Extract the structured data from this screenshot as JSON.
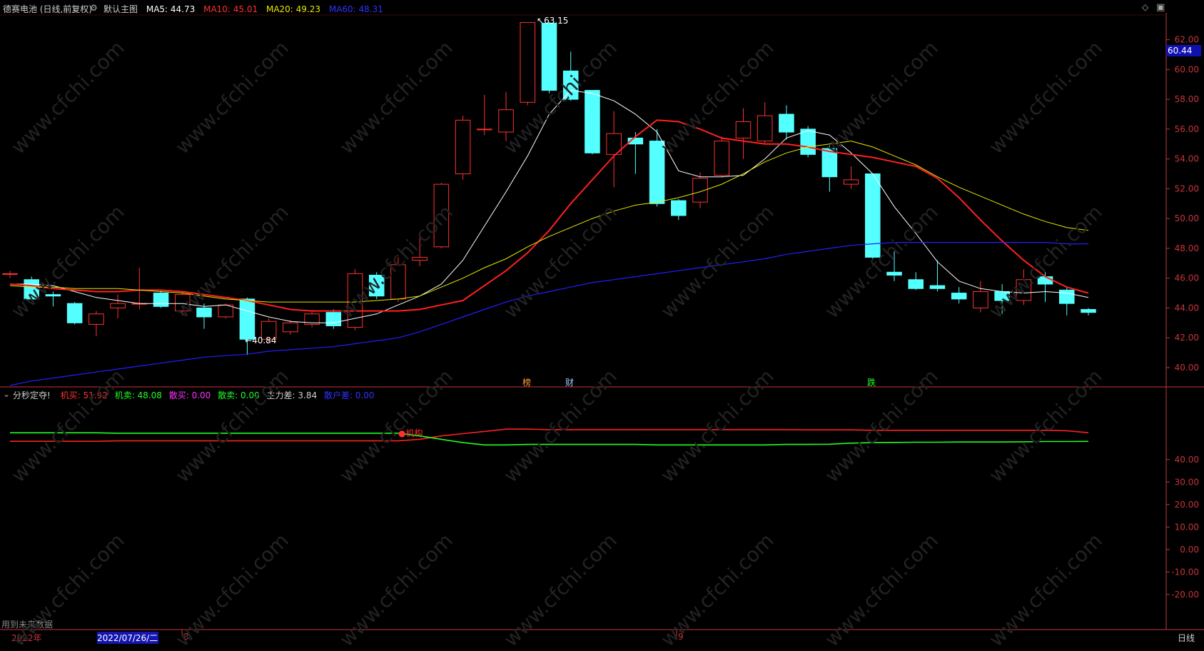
{
  "header": {
    "stock_name": "德赛电池 (日线,前复权)",
    "main_label": "默认主图",
    "ma5_label": "MA5: 44.73",
    "ma10_label": "MA10: 45.01",
    "ma20_label": "MA20: 49.23",
    "ma60_label": "MA60: 48.31"
  },
  "sub_header": {
    "indicator_name": "分秒定夺!",
    "jimai_label": "机买: 51.92",
    "jimai2_label": "机卖: 48.08",
    "sanmai_label": "散买: 0.00",
    "sanmai2_label": "散卖: 0.00",
    "zhuli_label": "主力差: 3.84",
    "sanhu_label": "散户差: 0.00"
  },
  "annotations": {
    "high": "63.15",
    "low": "40.84",
    "bang": "榜",
    "cai": "财",
    "die": "跌",
    "jigou": "机构"
  },
  "price_tag": "60.44",
  "footer": {
    "note": "用到未来数据",
    "year": "2022年",
    "date": "2022/07/26/二",
    "month8": "8",
    "month9": "9",
    "period": "日线"
  },
  "watermark": "www.cfchi.com",
  "colors": {
    "up": "#ff3232",
    "down": "#54ffff",
    "ma5": "#ffffff",
    "ma10": "#ff2020",
    "ma20": "#e8e800",
    "ma60": "#2020ff",
    "axis": "#c8353a"
  },
  "chart_data": [
    {
      "type": "candlestick",
      "title": "德赛电池 (日线,前复权)",
      "y_ticks": [
        "62.00",
        "60.00",
        "58.00",
        "56.00",
        "54.00",
        "52.00",
        "50.00",
        "48.00",
        "46.00",
        "44.00",
        "42.00",
        "40.00"
      ],
      "ylim": [
        38.8,
        63.8
      ],
      "candles": [
        {
          "o": 46.3,
          "c": 46.3,
          "h": 46.5,
          "l": 46.0
        },
        {
          "o": 45.9,
          "c": 44.6,
          "h": 46.1,
          "l": 44.5
        },
        {
          "o": 44.9,
          "c": 44.8,
          "h": 45.1,
          "l": 44.1
        },
        {
          "o": 44.3,
          "c": 43.0,
          "h": 44.4,
          "l": 42.9
        },
        {
          "o": 42.9,
          "c": 43.6,
          "h": 43.8,
          "l": 42.1
        },
        {
          "o": 44.0,
          "c": 44.3,
          "h": 44.9,
          "l": 43.3
        },
        {
          "o": 44.3,
          "c": 44.3,
          "h": 46.7,
          "l": 43.9
        },
        {
          "o": 45.0,
          "c": 44.1,
          "h": 45.2,
          "l": 44.0
        },
        {
          "o": 43.8,
          "c": 44.9,
          "h": 45.1,
          "l": 43.5
        },
        {
          "o": 44.0,
          "c": 43.4,
          "h": 44.3,
          "l": 42.6
        },
        {
          "o": 43.4,
          "c": 44.2,
          "h": 44.3,
          "l": 43.3
        },
        {
          "o": 44.6,
          "c": 41.9,
          "h": 44.7,
          "l": 40.84
        },
        {
          "o": 41.9,
          "c": 43.1,
          "h": 43.3,
          "l": 41.7
        },
        {
          "o": 42.4,
          "c": 43.0,
          "h": 43.2,
          "l": 42.2
        },
        {
          "o": 42.9,
          "c": 43.6,
          "h": 43.8,
          "l": 42.7
        },
        {
          "o": 43.7,
          "c": 42.8,
          "h": 43.9,
          "l": 42.6
        },
        {
          "o": 42.7,
          "c": 46.3,
          "h": 46.6,
          "l": 42.5
        },
        {
          "o": 46.2,
          "c": 44.8,
          "h": 46.4,
          "l": 44.6
        },
        {
          "o": 44.6,
          "c": 46.9,
          "h": 47.4,
          "l": 44.4
        },
        {
          "o": 47.2,
          "c": 47.4,
          "h": 48.7,
          "l": 46.8
        },
        {
          "o": 48.1,
          "c": 52.3,
          "h": 52.4,
          "l": 48.0
        },
        {
          "o": 53.0,
          "c": 56.6,
          "h": 56.9,
          "l": 52.6
        },
        {
          "o": 56.0,
          "c": 56.0,
          "h": 58.3,
          "l": 55.6
        },
        {
          "o": 55.8,
          "c": 57.3,
          "h": 58.5,
          "l": 55.2
        },
        {
          "o": 57.8,
          "c": 63.15,
          "h": 63.15,
          "l": 57.6
        },
        {
          "o": 63.1,
          "c": 58.6,
          "h": 63.2,
          "l": 58.4
        },
        {
          "o": 59.9,
          "c": 58.0,
          "h": 61.2,
          "l": 57.9
        },
        {
          "o": 58.6,
          "c": 54.4,
          "h": 58.6,
          "l": 54.3
        },
        {
          "o": 54.3,
          "c": 55.7,
          "h": 57.2,
          "l": 52.1
        },
        {
          "o": 55.4,
          "c": 55.0,
          "h": 55.8,
          "l": 53.0
        },
        {
          "o": 55.2,
          "c": 51.0,
          "h": 56.0,
          "l": 50.8
        },
        {
          "o": 51.2,
          "c": 50.2,
          "h": 51.3,
          "l": 49.9
        },
        {
          "o": 51.1,
          "c": 52.7,
          "h": 53.1,
          "l": 50.7
        },
        {
          "o": 52.9,
          "c": 55.2,
          "h": 55.5,
          "l": 52.8
        },
        {
          "o": 55.4,
          "c": 56.5,
          "h": 57.4,
          "l": 54.0
        },
        {
          "o": 55.2,
          "c": 56.9,
          "h": 57.8,
          "l": 55.0
        },
        {
          "o": 57.0,
          "c": 55.8,
          "h": 57.6,
          "l": 55.3
        },
        {
          "o": 56.0,
          "c": 54.3,
          "h": 56.2,
          "l": 54.1
        },
        {
          "o": 54.7,
          "c": 52.8,
          "h": 54.9,
          "l": 51.8
        },
        {
          "o": 52.3,
          "c": 52.6,
          "h": 53.5,
          "l": 52.0
        },
        {
          "o": 53.0,
          "c": 47.4,
          "h": 53.0,
          "l": 47.3
        },
        {
          "o": 46.4,
          "c": 46.2,
          "h": 47.8,
          "l": 45.8
        },
        {
          "o": 45.9,
          "c": 45.3,
          "h": 46.4,
          "l": 45.2
        },
        {
          "o": 45.5,
          "c": 45.3,
          "h": 47.2,
          "l": 45.1
        },
        {
          "o": 45.0,
          "c": 44.6,
          "h": 45.4,
          "l": 44.3
        },
        {
          "o": 44.0,
          "c": 45.1,
          "h": 45.8,
          "l": 43.7
        },
        {
          "o": 45.1,
          "c": 44.5,
          "h": 45.6,
          "l": 43.6
        },
        {
          "o": 44.5,
          "c": 45.9,
          "h": 46.6,
          "l": 44.2
        },
        {
          "o": 46.1,
          "c": 45.6,
          "h": 46.4,
          "l": 44.4
        },
        {
          "o": 45.2,
          "c": 44.3,
          "h": 45.4,
          "l": 43.5
        },
        {
          "o": 43.9,
          "c": 43.7,
          "h": 44.0,
          "l": 43.5
        }
      ],
      "series": [
        {
          "name": "MA5",
          "values": [
            45.6,
            45.6,
            45.5,
            45.1,
            44.7,
            44.5,
            44.3,
            44.3,
            44.3,
            44.1,
            44.2,
            43.8,
            43.4,
            43.1,
            43.0,
            43.0,
            43.3,
            43.6,
            44.2,
            44.8,
            45.6,
            47.2,
            49.5,
            51.8,
            54.2,
            57.0,
            58.6,
            58.4,
            57.9,
            57.0,
            55.8,
            53.2,
            52.8,
            52.8,
            52.9,
            54.0,
            55.4,
            55.9,
            55.6,
            54.4,
            53.0,
            50.8,
            49.0,
            47.1,
            45.8,
            45.3,
            45.1,
            45.0,
            45.1,
            45.0,
            44.7
          ]
        },
        {
          "name": "MA10",
          "values": [
            45.6,
            45.5,
            45.3,
            45.2,
            45.1,
            45.1,
            45.2,
            45.2,
            45.1,
            44.9,
            44.7,
            44.5,
            44.2,
            43.9,
            43.8,
            43.8,
            43.8,
            43.8,
            43.8,
            43.9,
            44.2,
            44.5,
            45.5,
            46.5,
            47.7,
            49.2,
            51.0,
            52.6,
            54.2,
            55.5,
            56.6,
            56.5,
            56.0,
            55.4,
            55.2,
            55.0,
            55.0,
            54.8,
            54.5,
            54.3,
            54.1,
            53.8,
            53.5,
            52.7,
            51.4,
            49.9,
            48.5,
            47.2,
            46.1,
            45.4,
            45.0
          ]
        },
        {
          "name": "MA20",
          "values": [
            45.5,
            45.4,
            45.4,
            45.3,
            45.3,
            45.3,
            45.2,
            45.1,
            45.0,
            44.8,
            44.6,
            44.5,
            44.4,
            44.4,
            44.4,
            44.4,
            44.4,
            44.5,
            44.6,
            44.8,
            45.4,
            46.0,
            46.7,
            47.3,
            48.1,
            48.8,
            49.4,
            50.0,
            50.5,
            50.9,
            51.1,
            51.4,
            51.8,
            52.3,
            53.0,
            53.8,
            54.4,
            54.8,
            55.0,
            55.2,
            54.8,
            54.2,
            53.6,
            52.8,
            52.1,
            51.5,
            50.9,
            50.3,
            49.8,
            49.4,
            49.2
          ]
        },
        {
          "name": "MA60",
          "values": [
            38.8,
            39.1,
            39.3,
            39.5,
            39.7,
            39.9,
            40.1,
            40.3,
            40.5,
            40.7,
            40.8,
            40.9,
            41.1,
            41.2,
            41.3,
            41.4,
            41.6,
            41.8,
            42.0,
            42.4,
            42.9,
            43.4,
            43.9,
            44.4,
            44.8,
            45.1,
            45.4,
            45.7,
            45.9,
            46.1,
            46.3,
            46.5,
            46.7,
            46.9,
            47.1,
            47.3,
            47.6,
            47.8,
            48.0,
            48.2,
            48.3,
            48.4,
            48.4,
            48.4,
            48.4,
            48.4,
            48.4,
            48.4,
            48.4,
            48.3,
            48.3
          ]
        }
      ]
    },
    {
      "type": "line",
      "title": "分秒定夺!",
      "y_ticks": [
        "40.00",
        "30.00",
        "20.00",
        "10.00",
        "0.00",
        "-10.00",
        "-20.00"
      ],
      "ylim": [
        -35,
        65
      ],
      "series": [
        {
          "name": "机买",
          "values": [
            48.1,
            48.1,
            48.1,
            48.1,
            48.1,
            48.3,
            48.3,
            48.3,
            48.3,
            48.3,
            48.3,
            48.3,
            48.3,
            48.3,
            48.3,
            48.3,
            48.3,
            48.3,
            48.3,
            49.0,
            50.5,
            51.5,
            52.5,
            53.5,
            53.5,
            53.3,
            53.3,
            53.3,
            53.3,
            53.3,
            53.3,
            53.3,
            53.3,
            53.3,
            53.3,
            53.3,
            53.3,
            53.2,
            53.2,
            53.2,
            53.0,
            53.0,
            53.0,
            53.0,
            53.0,
            53.0,
            53.0,
            53.0,
            53.0,
            52.8,
            51.92
          ]
        },
        {
          "name": "机卖",
          "values": [
            51.9,
            51.9,
            51.9,
            51.9,
            51.9,
            51.7,
            51.7,
            51.7,
            51.7,
            51.7,
            51.7,
            51.7,
            51.7,
            51.7,
            51.7,
            51.7,
            51.7,
            51.7,
            51.7,
            50.5,
            49.0,
            47.5,
            46.5,
            46.5,
            46.7,
            46.7,
            46.7,
            46.7,
            46.7,
            46.7,
            46.5,
            46.5,
            46.5,
            46.5,
            46.5,
            46.5,
            46.7,
            46.7,
            46.8,
            47.3,
            47.5,
            47.6,
            47.7,
            47.7,
            47.8,
            47.8,
            47.8,
            47.9,
            48.0,
            48.0,
            48.08
          ]
        }
      ]
    }
  ]
}
